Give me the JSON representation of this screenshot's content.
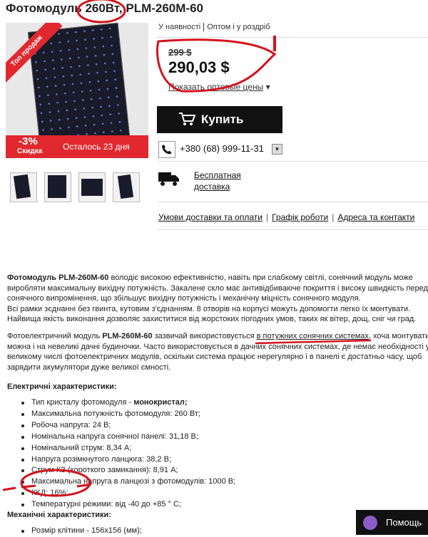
{
  "product": {
    "title": "Фотомодуль 260Вт, PLM-260M-60",
    "badge": "Топ продаж",
    "discount_pct": "-3%",
    "discount_label": "Скидка",
    "remaining": "Осталось 23 дня"
  },
  "availability": {
    "in_stock": "У наявності",
    "type": "Оптом і у роздріб"
  },
  "pricing": {
    "old_price": "299 $",
    "price": "290,03 $",
    "wholesale_link": "Показать оптовые цены"
  },
  "buy_button": "Купить",
  "phone": "+380 (68) 999-11-31",
  "delivery": {
    "line1": "Бесплатная",
    "line2": "доставка"
  },
  "info_links": [
    "Умови доставки та оплати",
    "Графік роботи",
    "Адреса та контакти"
  ],
  "description": {
    "p1_bold": "Фотомодуль PLM-260M-60",
    "p1_rest": " володіє високою ефективністю, навіть при слабкому світлі, сонячний модуль може виробляти максимальну вихідну потужність. Закалене скло має антивідбиваюче покриття і високу швидкість передачі сонячного випромінення, що збільшує вихідну потужність і механічну міцність сонячного модуля.",
    "p2": "Всі рамки зєднанні без гвинта, кутовим з'єднанням. 8 отворів на корпусі можуть допомогти легко їх монтувати.",
    "p3": "Найвища якість виконання дозволяє захиститися від жорстоких погодних умов, таких як вітер, дощ, сніг чи град.",
    "p4_a": "Фотоелектричний модуль ",
    "p4_bold": "PLM-260M-60",
    "p4_b": " зазвичай використовується ",
    "p4_u": "в потужних сонячних системах",
    "p4_c": ", хоча монтувати можна і на невеликі дачні будиночки. Часто використовується в дачних сонячних системах, де немає необхідності у великому числі фотоелектричних модулів, оскільки система працює нерегулярно і в панелі є достатньо часу, щоб зарядити акумулятори дуже великої ємності."
  },
  "electrical": {
    "heading": "Електричні характеристики:",
    "items": [
      "Тип кристалу фотомодуля - монокристал;",
      "Максимальна потужність фотомодуля: 260 Вт;",
      "Робоча напруга: 24 В;",
      "Номінальна напруга сонячної панелі: 31,18 В;",
      "Номінальний струм: 8,34 А;",
      "Напруга розімкнутого ланцюга: 38,2 В;",
      "Струм КЗ (короткого замикання): 8,91 А;",
      "Максимальна напруга в ланцюзі з фотомодулів: 1000 В;",
      "ККД: 16%;",
      "Температурні режими: від -40 до +85 ° С;"
    ]
  },
  "mechanical": {
    "heading": "Механічні характеристики:",
    "items": [
      "Розмір клітини - 156x156 (мм);"
    ]
  },
  "help_button": "Помощь",
  "colors": {
    "accent_red": "#e0282e",
    "annotation_red": "#d4121b",
    "button_black": "#111111"
  }
}
